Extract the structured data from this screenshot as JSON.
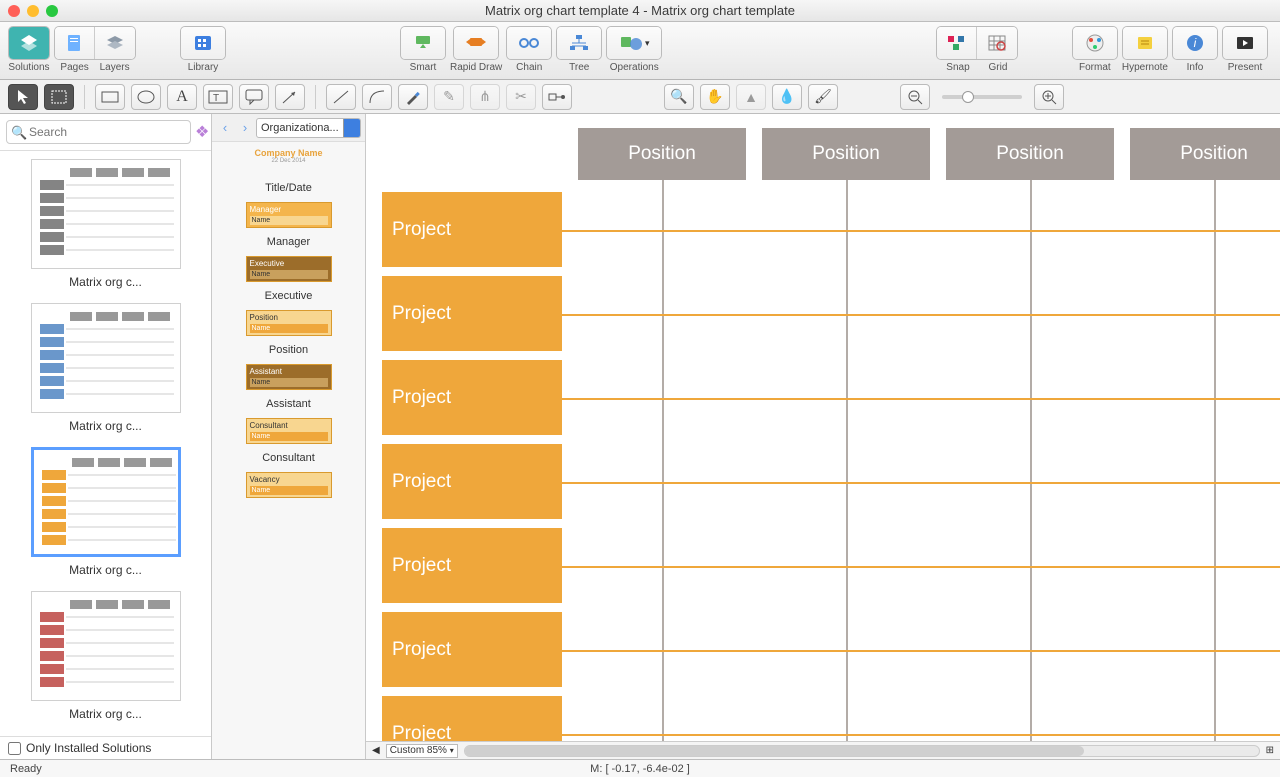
{
  "window": {
    "title": "Matrix org chart template 4 - Matrix org chart template"
  },
  "toolbar": {
    "solutions": "Solutions",
    "pages": "Pages",
    "layers": "Layers",
    "library": "Library",
    "smart": "Smart",
    "rapid": "Rapid Draw",
    "chain": "Chain",
    "tree": "Tree",
    "operations": "Operations",
    "snap": "Snap",
    "grid": "Grid",
    "format": "Format",
    "hypernote": "Hypernote",
    "info": "Info",
    "present": "Present"
  },
  "search": {
    "placeholder": "Search"
  },
  "thumbs": [
    {
      "caption": "Matrix org c..."
    },
    {
      "caption": "Matrix org c..."
    },
    {
      "caption": "Matrix org c...",
      "selected": true
    },
    {
      "caption": "Matrix org c..."
    }
  ],
  "onlyInstalled": "Only Installed Solutions",
  "library": {
    "combo": "Organizationa...",
    "companyName": "Company Name",
    "items": [
      {
        "label": "Title/Date"
      },
      {
        "label": "Manager"
      },
      {
        "label": "Executive"
      },
      {
        "label": "Position"
      },
      {
        "label": "Assistant"
      },
      {
        "label": "Consultant"
      }
    ],
    "vacancy": "Vacancy",
    "name": "Name"
  },
  "canvas": {
    "positions": [
      "Position",
      "Position",
      "Position",
      "Position"
    ],
    "projects": [
      "Project",
      "Project",
      "Project",
      "Project",
      "Project",
      "Project",
      "Project"
    ],
    "zoom": "Custom 85%"
  },
  "status": {
    "ready": "Ready",
    "mouse": "M: [ -0.17, -6.4e-02 ]"
  }
}
